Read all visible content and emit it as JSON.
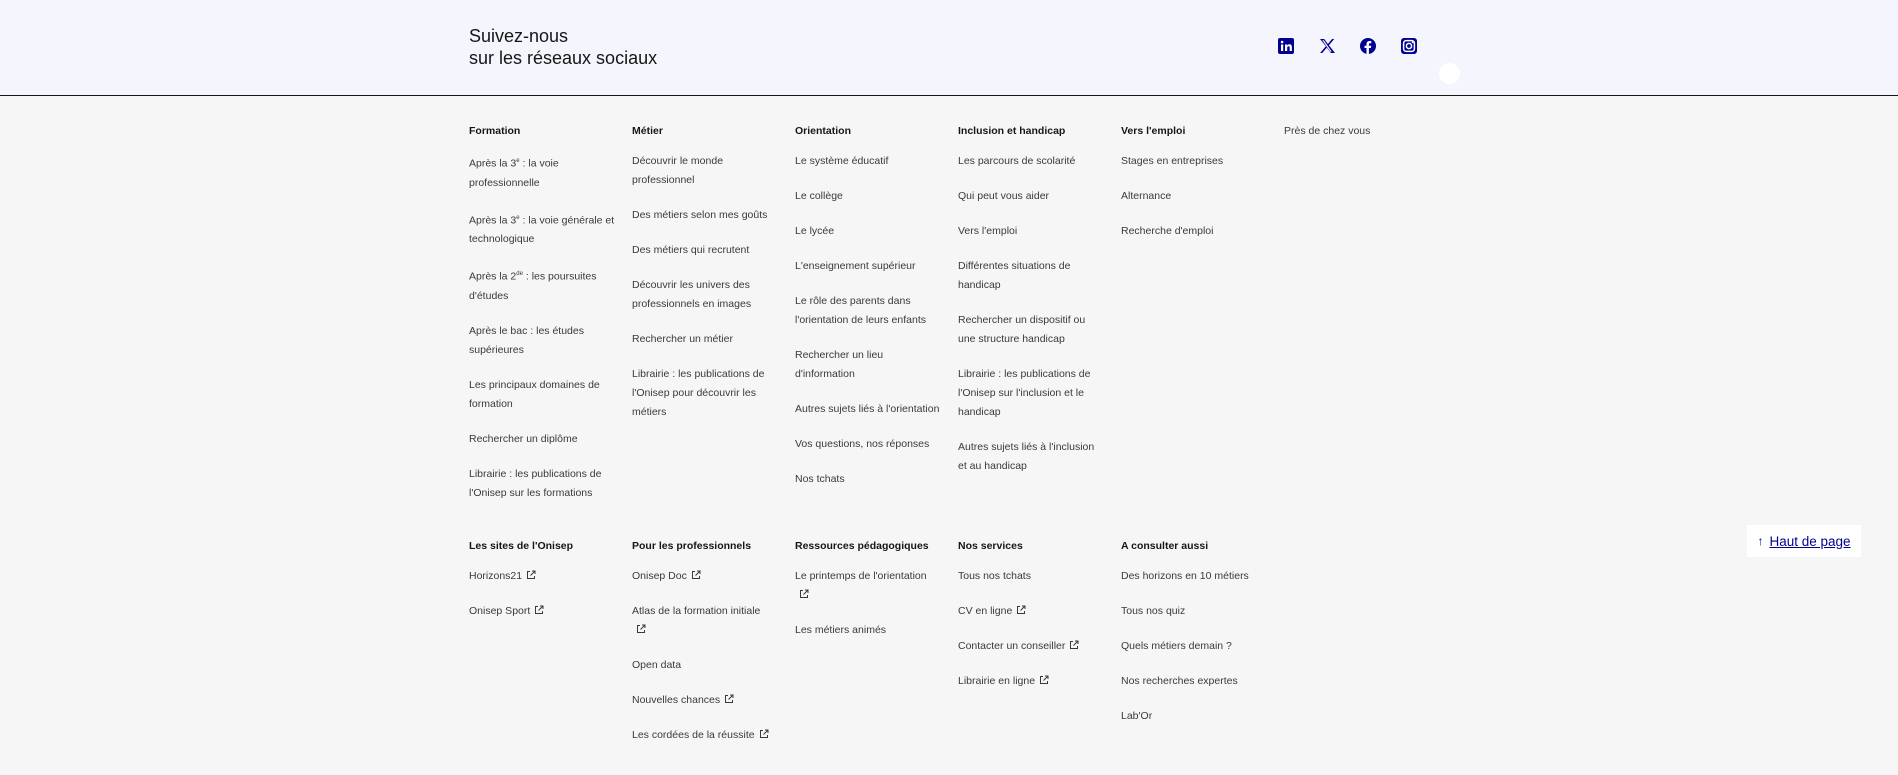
{
  "social": {
    "title_line1": "Suivez-nous",
    "title_line2": "sur les réseaux sociaux",
    "icons": [
      "linkedin-icon",
      "x-icon",
      "facebook-icon",
      "instagram-icon"
    ],
    "accent": "#000091"
  },
  "columns_top": [
    {
      "title": "Formation",
      "items": [
        [
          "Après la 3",
          "e",
          " : la voie professionnelle"
        ],
        [
          "Après la 3",
          "e",
          " : la voie générale et technologique"
        ],
        [
          "Après la 2",
          "de",
          " : les poursuites d'études"
        ],
        [
          "Après le bac : les études supérieures"
        ],
        [
          "Les principaux domaines de formation"
        ],
        [
          "Rechercher un diplôme"
        ],
        [
          "Librairie : les publications de l'Onisep sur les formations"
        ]
      ]
    },
    {
      "title": "Métier",
      "items": [
        "Découvrir le monde professionnel",
        "Des métiers selon mes goûts",
        "Des métiers qui recrutent",
        "Découvrir les univers des professionnels en images",
        "Rechercher un métier",
        "Librairie : les publications de l'Onisep pour découvrir les métiers"
      ]
    },
    {
      "title": "Orientation",
      "items": [
        "Le système éducatif",
        "Le collège",
        "Le lycée",
        "L'enseignement supérieur",
        "Le rôle des parents dans l'orientation de leurs enfants",
        "Rechercher un lieu d'information",
        "Autres sujets liés à l'orientation",
        "Vos questions, nos réponses",
        "Nos tchats"
      ]
    },
    {
      "title": "Inclusion et handicap",
      "items": [
        "Les parcours de scolarité",
        "Qui peut vous aider",
        "Vers l'emploi",
        "Différentes situations de handicap",
        "Rechercher un dispositif ou une structure handicap",
        "Librairie : les publications de l'Onisep sur l'inclusion et le handicap",
        "Autres sujets liés à l'inclusion et au handicap"
      ]
    },
    {
      "title": "Vers l'emploi",
      "items": [
        "Stages en entreprises",
        "Alternance",
        "Recherche d'emploi"
      ]
    },
    {
      "title": "Près de chez vous",
      "items": []
    }
  ],
  "columns_bottom": [
    {
      "title": "Les sites de l'Onisep",
      "items": [
        {
          "label": "Horizons21",
          "external": true
        },
        {
          "label": "Onisep Sport",
          "external": true
        }
      ]
    },
    {
      "title": "Pour les professionnels",
      "items": [
        {
          "label": "Onisep Doc",
          "external": true
        },
        {
          "label": "Atlas de la formation initiale",
          "external": true
        },
        {
          "label": "Open data",
          "external": false
        },
        {
          "label": "Nouvelles chances",
          "external": true
        },
        {
          "label": "Les cordées de la réussite",
          "external": true
        }
      ]
    },
    {
      "title": "Ressources pédagogiques",
      "items": [
        {
          "label": "Le printemps de l'orientation",
          "external": true
        },
        {
          "label": "Les métiers animés",
          "external": false
        }
      ]
    },
    {
      "title": "Nos services",
      "items": [
        {
          "label": "Tous nos tchats",
          "external": false
        },
        {
          "label": "CV en ligne",
          "external": true
        },
        {
          "label": "Contacter un conseiller",
          "external": true
        },
        {
          "label": "Librairie en ligne",
          "external": true
        }
      ]
    },
    {
      "title": "A consulter aussi",
      "items": [
        {
          "label": "Des horizons en 10 métiers",
          "external": false
        },
        {
          "label": "Tous nos quiz",
          "external": false
        },
        {
          "label": "Quels métiers demain ?",
          "external": false
        },
        {
          "label": "Nos recherches expertes",
          "external": false
        },
        {
          "label": "Lab'Or",
          "external": false
        }
      ]
    }
  ],
  "back_to_top": {
    "arrow": "↑",
    "label": "Haut de page"
  }
}
